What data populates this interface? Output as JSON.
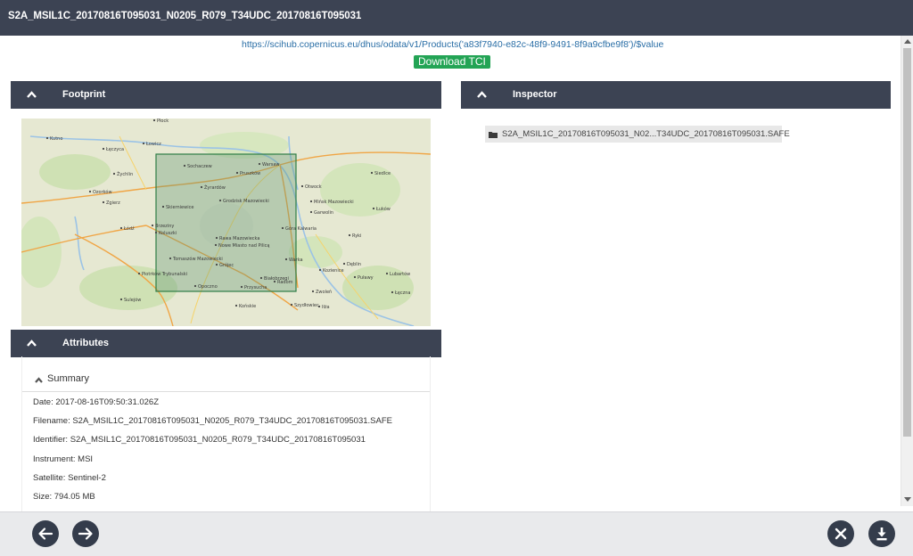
{
  "window": {
    "title": "S2A_MSIL1C_20170816T095031_N0205_R079_T34UDC_20170816T095031"
  },
  "product": {
    "link": "https://scihub.copernicus.eu/dhus/odata/v1/Products('a83f7940-e82c-48f9-9491-8f9a9cfbe9f8')/$value",
    "download_label": "Download TCI"
  },
  "panels": {
    "footprint": "Footprint",
    "inspector": "Inspector",
    "attributes": "Attributes"
  },
  "inspector": {
    "item": "S2A_MSIL1C_20170816T095031_N02...T34UDC_20170816T095031.SAFE"
  },
  "map": {
    "labels": [
      "Płock",
      "Kutno",
      "Łęczyca",
      "Łowicz",
      "Sochaczew",
      "Warsaw",
      "Pruszków",
      "Otwock",
      "Żyrardów",
      "Grodzisk Mazowiecki",
      "Mińsk Mazowiecki",
      "Siedlce",
      "Garwolin",
      "Łuków",
      "Łódź",
      "Skierniewice",
      "Rawa Mazowiecka",
      "Piotrków Trybunalski",
      "Tomaszów Mazowiecki",
      "Nowe Miasto nad Pilicą",
      "Grójec",
      "Góra Kalwaria",
      "Białobrzegi",
      "Warka",
      "Ryki",
      "Dęblin",
      "Radom",
      "Przysucha",
      "Opoczno",
      "Zgierz",
      "Ozorków",
      "Kozienice",
      "Zwoleń",
      "Puławy",
      "Lubartów",
      "Łęczna",
      "Żychlin",
      "Brzeziny",
      "Koluszki",
      "Sulejów",
      "Końskie",
      "Szydłowiec",
      "Iłża"
    ],
    "footprint_color": "#2e7d45"
  },
  "summary": {
    "label": "Summary",
    "rows": [
      "Date: 2017-08-16T09:50:31.026Z",
      "Filename: S2A_MSIL1C_20170816T095031_N0205_R079_T34UDC_20170816T095031.SAFE",
      "Identifier: S2A_MSIL1C_20170816T095031_N0205_R079_T34UDC_20170816T095031",
      "Instrument: MSI",
      "Satellite: Sentinel-2",
      "Size: 794.05 MB"
    ]
  },
  "footer": {
    "buttons": [
      "arrow-left-icon",
      "arrow-right-icon",
      "close-icon",
      "download-icon"
    ]
  },
  "colors": {
    "header": "#3c4353",
    "accent_green": "#23a455",
    "link": "#2a6ea6"
  }
}
